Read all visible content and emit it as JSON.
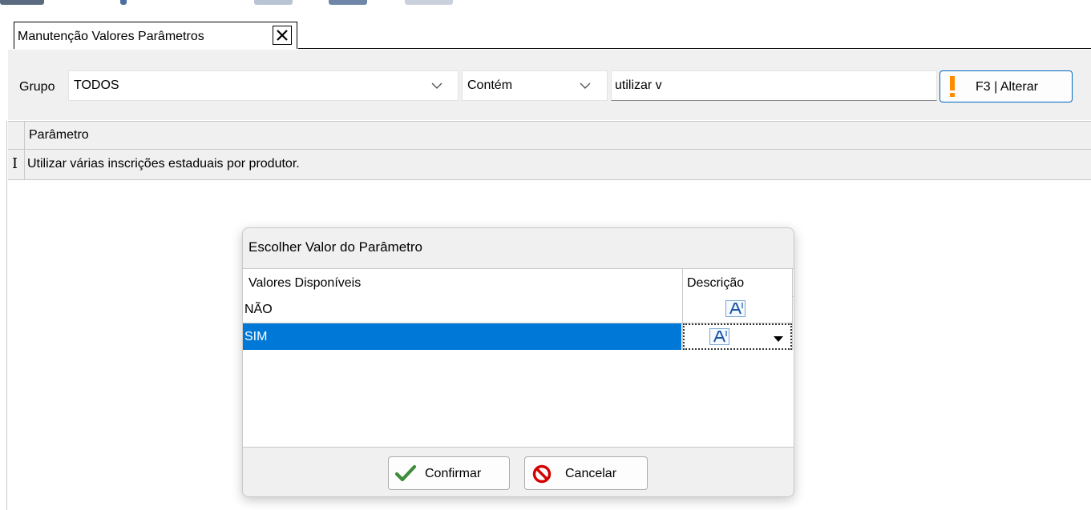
{
  "tab": {
    "title": "Manutenção Valores Parâmetros"
  },
  "filters": {
    "group_label": "Grupo",
    "group_value": "TODOS",
    "match_value": "Contém",
    "search_value": "utilizar v",
    "alter_button": "F3 | Alterar"
  },
  "grid": {
    "column": "Parâmetro",
    "rows": [
      "Utilizar várias inscrições estaduais por produtor."
    ]
  },
  "dialog": {
    "title": "Escolher Valor do Parâmetro",
    "columns": [
      "Valores Disponíveis",
      "Descrição"
    ],
    "rows": [
      "NÃO",
      "SIM"
    ],
    "selected_row": "SIM",
    "confirm_label": "Confirmar",
    "cancel_label": "Cancelar"
  },
  "colors": {
    "selection": "#0078d7",
    "alter_accent": "#ff8c00",
    "confirm_icon": "#3c8c3c",
    "cancel_icon": "#d40000"
  },
  "icons": [
    "close-icon",
    "chevron-down-icon",
    "exclamation-icon",
    "text-description-icon",
    "checkmark-icon",
    "prohibited-icon",
    "dropdown-arrow-icon",
    "text-cursor-icon"
  ]
}
